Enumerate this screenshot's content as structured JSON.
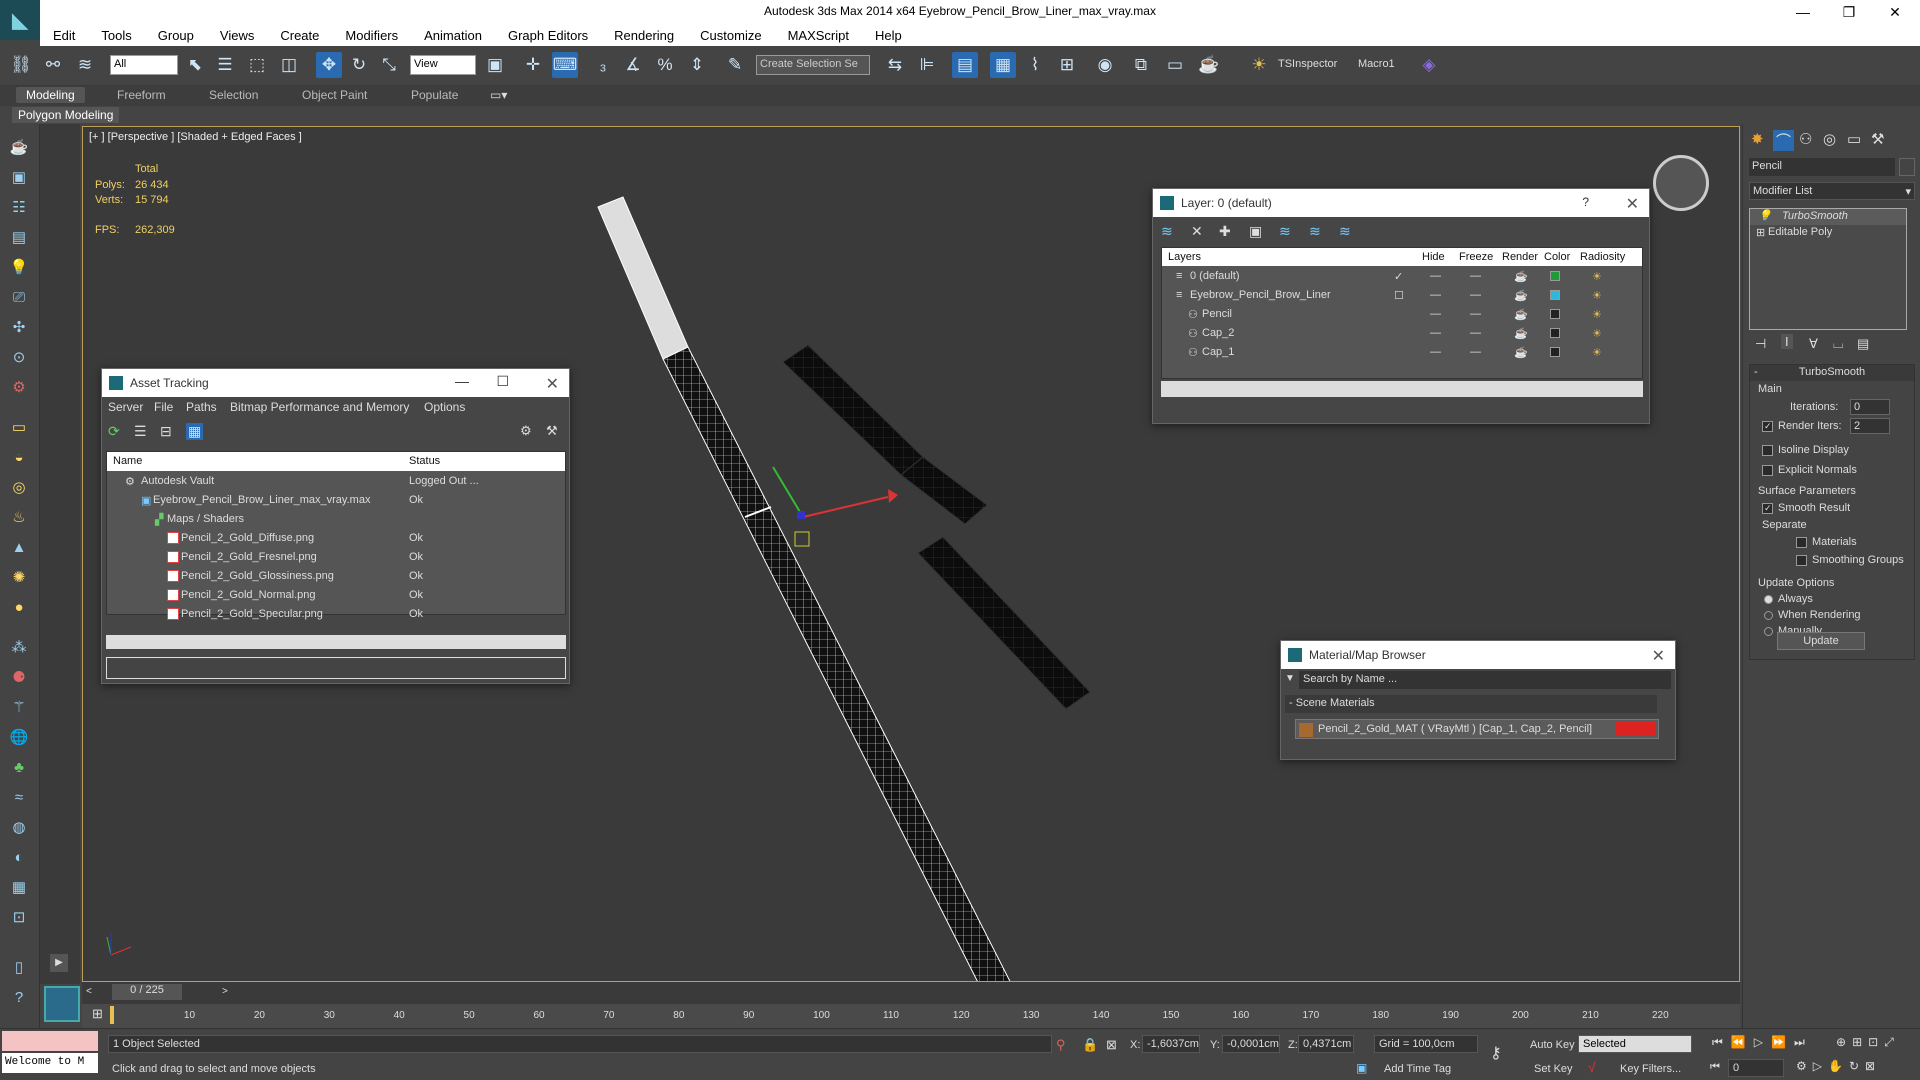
{
  "window": {
    "title": "Autodesk 3ds Max  2014 x64    Eyebrow_Pencil_Brow_Liner_max_vray.max",
    "minimize": "—",
    "maximize": "❐",
    "close": "✕"
  },
  "menu": [
    "Edit",
    "Tools",
    "Group",
    "Views",
    "Create",
    "Modifiers",
    "Animation",
    "Graph Editors",
    "Rendering",
    "Customize",
    "MAXScript",
    "Help"
  ],
  "toolbar": {
    "filter_value": "All",
    "refcoord_value": "View",
    "selection_set_placeholder": "Create Selection Se",
    "tsinspector": "TSInspector",
    "macro1": "Macro1"
  },
  "ribbon": {
    "tabs": [
      "Modeling",
      "Freeform",
      "Selection",
      "Object Paint",
      "Populate"
    ],
    "subpanel": "Polygon Modeling"
  },
  "viewport": {
    "label": "[+ ] [Perspective ] [Shaded + Edged Faces ]",
    "stats": {
      "total_label": "Total",
      "polys_label": "Polys:",
      "polys_value": "26 434",
      "verts_label": "Verts:",
      "verts_value": "15 794",
      "fps_label": "FPS:",
      "fps_value": "262,309"
    }
  },
  "asset_tracking": {
    "title": "Asset Tracking",
    "menu": [
      "Server",
      "File",
      "Paths",
      "Bitmap Performance and Memory",
      "Options"
    ],
    "columns": [
      "Name",
      "Status"
    ],
    "rows": [
      {
        "name": "Autodesk Vault",
        "status": "Logged Out ..."
      },
      {
        "name": "Eyebrow_Pencil_Brow_Liner_max_vray.max",
        "status": "Ok"
      },
      {
        "name": "Maps / Shaders",
        "status": ""
      },
      {
        "name": "Pencil_2_Gold_Diffuse.png",
        "status": "Ok"
      },
      {
        "name": "Pencil_2_Gold_Fresnel.png",
        "status": "Ok"
      },
      {
        "name": "Pencil_2_Gold_Glossiness.png",
        "status": "Ok"
      },
      {
        "name": "Pencil_2_Gold_Normal.png",
        "status": "Ok"
      },
      {
        "name": "Pencil_2_Gold_Specular.png",
        "status": "Ok"
      }
    ]
  },
  "layer_dialog": {
    "title": "Layer: 0 (default)",
    "help": "?",
    "columns": [
      "Layers",
      "Hide",
      "Freeze",
      "Render",
      "Color",
      "Radiosity"
    ],
    "rows": [
      {
        "name": "0 (default)",
        "color": "#1f9a3a"
      },
      {
        "name": "Eyebrow_Pencil_Brow_Liner",
        "color": "#2fb8d8"
      },
      {
        "name": "Pencil",
        "color": "#222222"
      },
      {
        "name": "Cap_2",
        "color": "#222222"
      },
      {
        "name": "Cap_1",
        "color": "#222222"
      }
    ]
  },
  "material_browser": {
    "title": "Material/Map Browser",
    "search_placeholder": "Search by Name ...",
    "section": "Scene Materials",
    "item": "Pencil_2_Gold_MAT  ( VRayMtl )  [Cap_1, Cap_2, Pencil]"
  },
  "command_panel": {
    "object_name": "Pencil",
    "modifier_list": "Modifier List",
    "stack": [
      "TurboSmooth",
      "Editable Poly"
    ],
    "rollout_title": "TurboSmooth",
    "main_label": "Main",
    "iterations_label": "Iterations:",
    "iterations_value": "0",
    "render_iters_label": "Render Iters:",
    "render_iters_value": "2",
    "isoline": "Isoline Display",
    "explicit_normals": "Explicit Normals",
    "surface_params": "Surface Parameters",
    "smooth_result": "Smooth Result",
    "separate": "Separate",
    "materials": "Materials",
    "smoothing_groups": "Smoothing Groups",
    "update_options": "Update Options",
    "always": "Always",
    "when_rendering": "When Rendering",
    "manually": "Manually",
    "update_button": "Update"
  },
  "timeline": {
    "frame": "0 / 225",
    "ticks": [
      "10",
      "20",
      "30",
      "40",
      "50",
      "60",
      "70",
      "80",
      "90",
      "100",
      "110",
      "120",
      "130",
      "140",
      "150",
      "160",
      "170",
      "180",
      "190",
      "200",
      "210",
      "220"
    ]
  },
  "status": {
    "maxscript": "Welcome to M",
    "selected": "1 Object Selected",
    "prompt": "Click and drag to select and move objects",
    "x_label": "X:",
    "x_value": "-1,6037cm",
    "y_label": "Y:",
    "y_value": "-0,0001cm",
    "z_label": "Z:",
    "z_value": "0,4371cm",
    "grid": "Grid = 100,0cm",
    "add_time_tag": "Add Time Tag",
    "auto_key": "Auto Key",
    "set_key": "Set Key",
    "selected_dropdown": "Selected",
    "key_filters": "Key Filters...",
    "frame_value": "0"
  }
}
